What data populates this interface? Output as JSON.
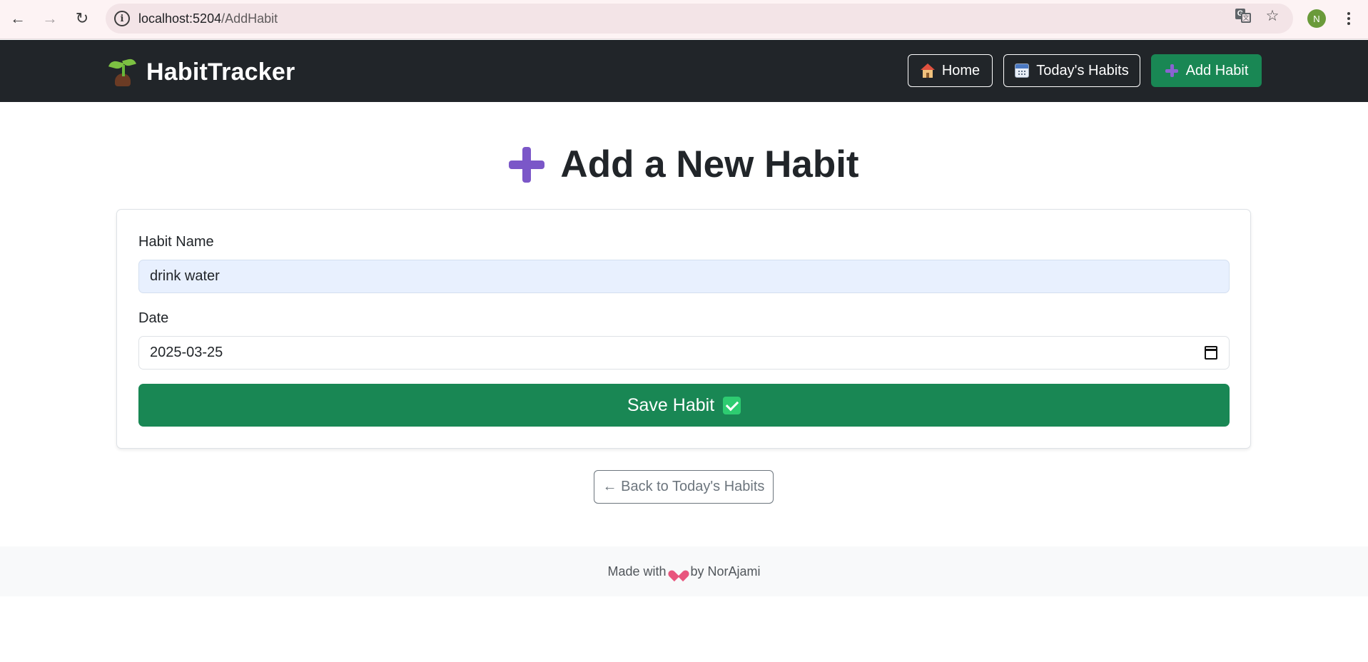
{
  "browser": {
    "url_host": "localhost:5204",
    "url_path": "/AddHabit",
    "profile_initial": "N",
    "back_icon": "←",
    "forward_icon": "→",
    "reload_icon": "↻",
    "star_icon": "☆"
  },
  "navbar": {
    "brand": "HabitTracker",
    "links": [
      {
        "label": "Home",
        "icon": "house-icon"
      },
      {
        "label": "Today's Habits",
        "icon": "calendar-icon"
      },
      {
        "label": "Add Habit",
        "icon": "plus-icon"
      }
    ]
  },
  "page": {
    "title": "Add a New Habit",
    "form": {
      "name_label": "Habit Name",
      "name_value": "drink water",
      "date_label": "Date",
      "date_value": "2025-03-25",
      "save_label": "Save Habit"
    },
    "back_label": "← Back to Today's Habits"
  },
  "footer": {
    "made_with": "Made with",
    "by": "by NorAjami"
  },
  "colors": {
    "navbar_bg": "#212529",
    "success": "#198754",
    "accent_purple": "#7b57c8"
  }
}
